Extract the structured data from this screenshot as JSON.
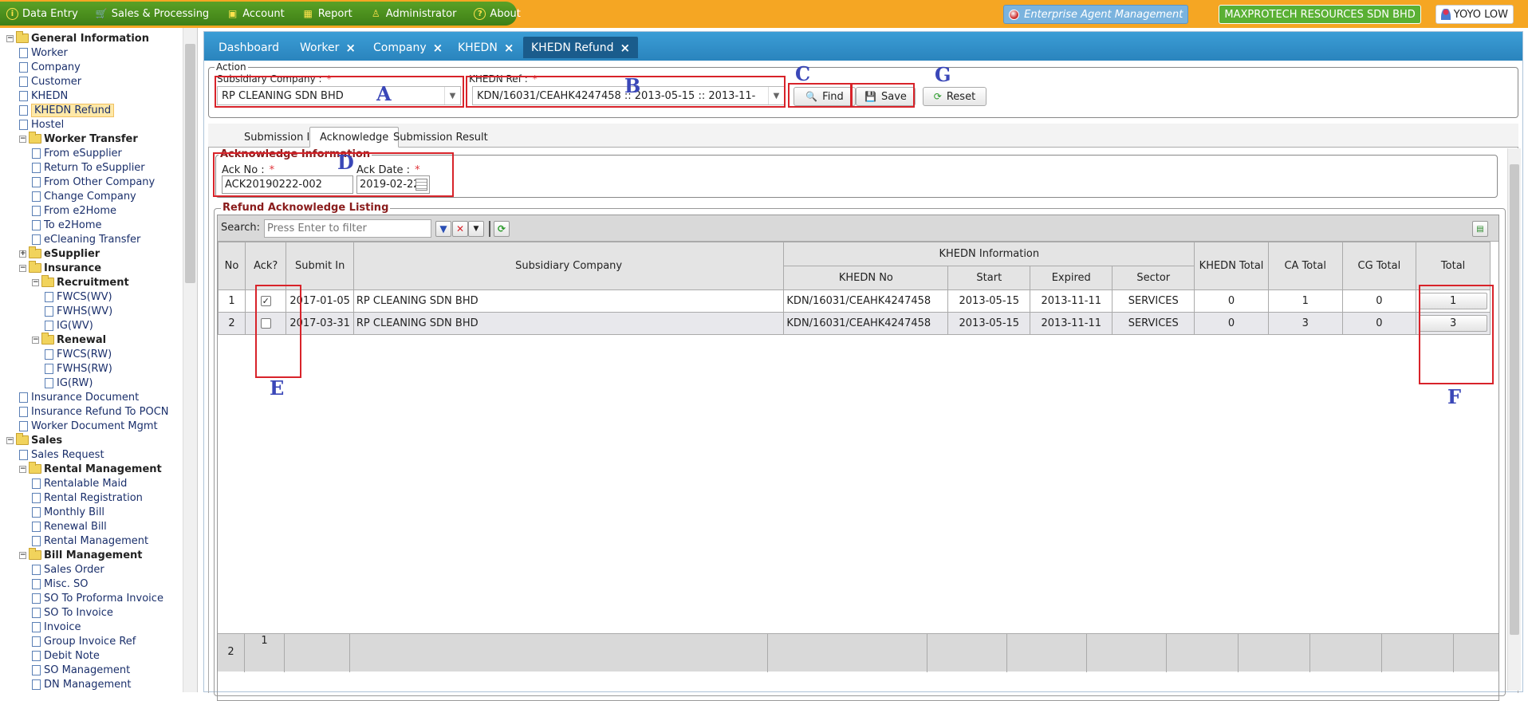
{
  "menu": [
    {
      "label": "Data Entry",
      "icon": "info-icon"
    },
    {
      "label": "Sales & Processing",
      "icon": "cart-icon"
    },
    {
      "label": "Account",
      "icon": "wallet-icon"
    },
    {
      "label": "Report",
      "icon": "grid-icon"
    },
    {
      "label": "Administrator",
      "icon": "admin-icon"
    },
    {
      "label": "About",
      "icon": "help-icon"
    }
  ],
  "header": {
    "app_name": "Enterprise Agent Management",
    "company": "MAXPROTECH RESOURCES SDN BHD",
    "user": "YOYO LOW"
  },
  "sidebar": {
    "items": [
      {
        "label": "General Information",
        "level": 0,
        "type": "folder",
        "open": true
      },
      {
        "label": "Worker",
        "level": 1,
        "type": "doc"
      },
      {
        "label": "Company",
        "level": 1,
        "type": "doc"
      },
      {
        "label": "Customer",
        "level": 1,
        "type": "doc"
      },
      {
        "label": "KHEDN",
        "level": 1,
        "type": "doc"
      },
      {
        "label": "KHEDN Refund",
        "level": 1,
        "type": "doc",
        "selected": true
      },
      {
        "label": "Hostel",
        "level": 1,
        "type": "doc"
      },
      {
        "label": "Worker Transfer",
        "level": 1,
        "type": "folder",
        "open": true
      },
      {
        "label": "From eSupplier",
        "level": 2,
        "type": "doc"
      },
      {
        "label": "Return To eSupplier",
        "level": 2,
        "type": "doc"
      },
      {
        "label": "From Other Company",
        "level": 2,
        "type": "doc"
      },
      {
        "label": "Change Company",
        "level": 2,
        "type": "doc"
      },
      {
        "label": "From e2Home",
        "level": 2,
        "type": "doc"
      },
      {
        "label": "To e2Home",
        "level": 2,
        "type": "doc"
      },
      {
        "label": "eCleaning Transfer",
        "level": 2,
        "type": "doc"
      },
      {
        "label": "eSupplier",
        "level": 1,
        "type": "folder",
        "open": false
      },
      {
        "label": "Insurance",
        "level": 1,
        "type": "folder",
        "open": true
      },
      {
        "label": "Recruitment",
        "level": 2,
        "type": "folder",
        "open": true
      },
      {
        "label": "FWCS(WV)",
        "level": 3,
        "type": "doc"
      },
      {
        "label": "FWHS(WV)",
        "level": 3,
        "type": "doc"
      },
      {
        "label": "IG(WV)",
        "level": 3,
        "type": "doc"
      },
      {
        "label": "Renewal",
        "level": 2,
        "type": "folder",
        "open": true
      },
      {
        "label": "FWCS(RW)",
        "level": 3,
        "type": "doc"
      },
      {
        "label": "FWHS(RW)",
        "level": 3,
        "type": "doc"
      },
      {
        "label": "IG(RW)",
        "level": 3,
        "type": "doc"
      },
      {
        "label": "Insurance Document",
        "level": 1,
        "type": "doc"
      },
      {
        "label": "Insurance Refund To POCN",
        "level": 1,
        "type": "doc"
      },
      {
        "label": "Worker Document Mgmt",
        "level": 1,
        "type": "doc"
      },
      {
        "label": "Sales",
        "level": 0,
        "type": "folder",
        "open": true
      },
      {
        "label": "Sales Request",
        "level": 1,
        "type": "doc"
      },
      {
        "label": "Rental Management",
        "level": 1,
        "type": "folder",
        "open": true
      },
      {
        "label": "Rentalable Maid",
        "level": 2,
        "type": "doc"
      },
      {
        "label": "Rental Registration",
        "level": 2,
        "type": "doc"
      },
      {
        "label": "Monthly Bill",
        "level": 2,
        "type": "doc"
      },
      {
        "label": "Renewal Bill",
        "level": 2,
        "type": "doc"
      },
      {
        "label": "Rental Management",
        "level": 2,
        "type": "doc"
      },
      {
        "label": "Bill Management",
        "level": 1,
        "type": "folder",
        "open": true
      },
      {
        "label": "Sales Order",
        "level": 2,
        "type": "doc"
      },
      {
        "label": "Misc. SO",
        "level": 2,
        "type": "doc"
      },
      {
        "label": "SO To Proforma Invoice",
        "level": 2,
        "type": "doc"
      },
      {
        "label": "SO To Invoice",
        "level": 2,
        "type": "doc"
      },
      {
        "label": "Invoice",
        "level": 2,
        "type": "doc"
      },
      {
        "label": "Group Invoice Ref",
        "level": 2,
        "type": "doc"
      },
      {
        "label": "Debit Note",
        "level": 2,
        "type": "doc"
      },
      {
        "label": "SO Management",
        "level": 2,
        "type": "doc"
      },
      {
        "label": "DN Management",
        "level": 2,
        "type": "doc"
      }
    ]
  },
  "tabs": [
    {
      "label": "Dashboard",
      "closable": false
    },
    {
      "label": "Worker",
      "closable": true
    },
    {
      "label": "Company",
      "closable": true
    },
    {
      "label": "KHEDN",
      "closable": true
    },
    {
      "label": "KHEDN Refund",
      "closable": true,
      "active": true
    }
  ],
  "action": {
    "legend": "Action",
    "subsidiary_label": "Subsidiary Company :",
    "subsidiary_value": "RP CLEANING SDN BHD",
    "khedn_label": "KHEDN Ref :",
    "khedn_value": "KDN/16031/CEAHK4247458 :: 2013-05-15 :: 2013-11-",
    "find_label": "Find",
    "save_label": "Save",
    "reset_label": "Reset",
    "required_mark": "*"
  },
  "inner_tabs": [
    "Submission In",
    "Acknowledge",
    "Submission Result"
  ],
  "acknowledge": {
    "legend": "Acknowledge Information",
    "ack_no_label": "Ack No :",
    "ack_no_value": "ACK20190222-002",
    "ack_date_label": "Ack Date :",
    "ack_date_value": "2019-02-22"
  },
  "listing": {
    "legend": "Refund Acknowledge Listing",
    "search_label": "Search:",
    "search_placeholder": "Press Enter to filter",
    "columns": {
      "no": "No",
      "ack": "Ack?",
      "submit_in": "Submit In",
      "subsidiary": "Subsidiary Company",
      "khedn_info": "KHEDN Information",
      "khedn_no": "KHEDN No",
      "start": "Start",
      "expired": "Expired",
      "sector": "Sector",
      "khedn_total": "KHEDN Total",
      "ca_total": "CA Total",
      "cg_total": "CG Total",
      "total": "Total"
    },
    "rows": [
      {
        "no": "1",
        "ack": true,
        "submit_in": "2017-01-05",
        "subsidiary": "RP CLEANING SDN BHD",
        "khedn_no": "KDN/16031/CEAHK4247458",
        "start": "2013-05-15",
        "expired": "2013-11-11",
        "sector": "SERVICES",
        "khedn_total": "0",
        "ca_total": "1",
        "cg_total": "0",
        "total": "1"
      },
      {
        "no": "2",
        "ack": false,
        "submit_in": "2017-03-31",
        "subsidiary": "RP CLEANING SDN BHD",
        "khedn_no": "KDN/16031/CEAHK4247458",
        "start": "2013-05-15",
        "expired": "2013-11-11",
        "sector": "SERVICES",
        "khedn_total": "0",
        "ca_total": "3",
        "cg_total": "0",
        "total": "3"
      }
    ],
    "footer": {
      "count": "2",
      "ack_count": "1"
    }
  },
  "annotations": {
    "a": "A",
    "b": "B",
    "c": "C",
    "d": "D",
    "e": "E",
    "f": "F",
    "g": "G"
  },
  "colors": {
    "accent": "#f5a623",
    "menu_green": "#4a8f1c",
    "tab_blue": "#2a84bd",
    "highlight_red": "#d8232a",
    "annotation_blue": "#3a47b8"
  }
}
